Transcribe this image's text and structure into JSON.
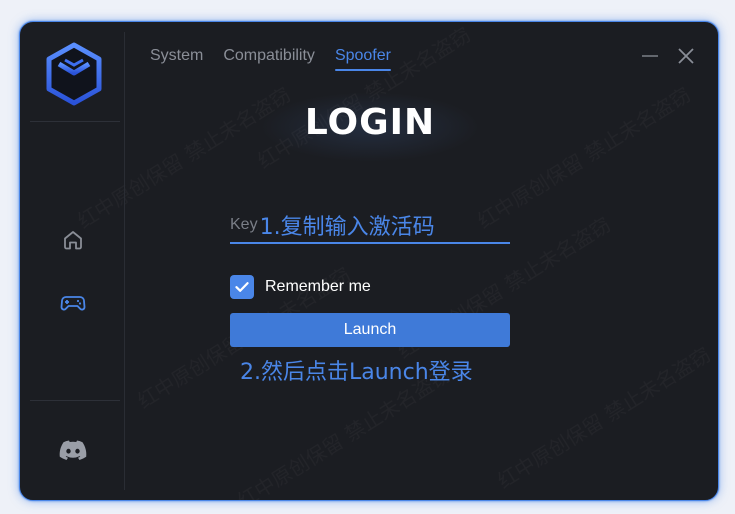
{
  "tabs": [
    {
      "label": "System",
      "active": false
    },
    {
      "label": "Compatibility",
      "active": false
    },
    {
      "label": "Spoofer",
      "active": true
    }
  ],
  "window_controls": {
    "minimize_icon": "minimize-icon",
    "close_icon": "close-icon"
  },
  "sidebar": {
    "logo_icon": "cube-logo-icon",
    "items": [
      {
        "icon": "home-icon",
        "active": false
      },
      {
        "icon": "gamepad-icon",
        "active": true
      },
      {
        "icon": "discord-icon",
        "active": false
      }
    ]
  },
  "login": {
    "title": "LOGIN",
    "key_placeholder": "Key",
    "key_value": "1.复制输入激活码",
    "remember_label": "Remember me",
    "remember_checked": true,
    "launch_label": "Launch",
    "hint": "2.然后点击Launch登录"
  },
  "watermark_text": "红中原创保留 禁止未名盗窃",
  "colors": {
    "accent": "#4a86e8",
    "background": "#1b1d22",
    "text": "#ffffff",
    "muted": "#8a8e97"
  }
}
